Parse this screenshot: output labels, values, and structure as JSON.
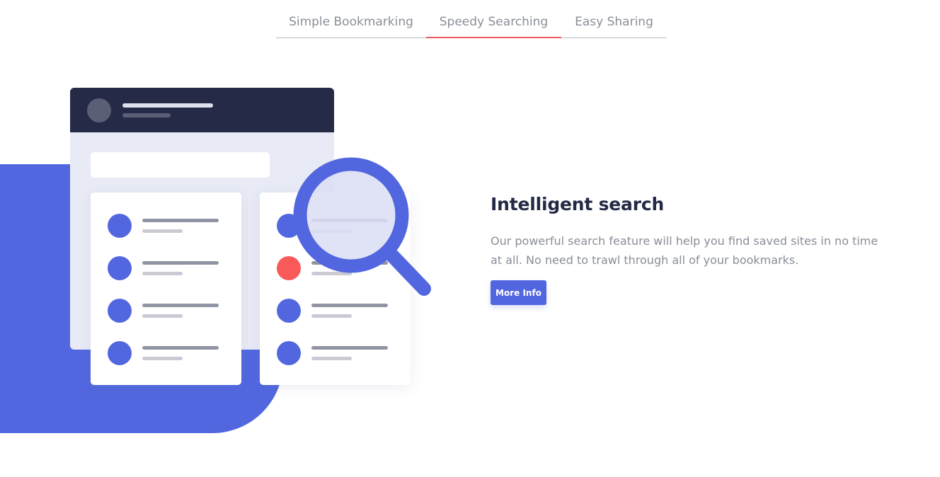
{
  "tabs": [
    {
      "label": "Simple Bookmarking",
      "active": false
    },
    {
      "label": "Speedy Searching",
      "active": true
    },
    {
      "label": "Easy Sharing",
      "active": false
    }
  ],
  "feature": {
    "title": "Intelligent search",
    "description": "Our powerful search feature will help you find saved sites in no time at all. No need to trawl through all of your bookmarks.",
    "button_label": "More Info"
  },
  "colors": {
    "brand_blue": "#5267df",
    "accent_red": "#fa5959",
    "dark_navy": "#242a45",
    "gray_text": "#9194a2"
  },
  "illustration": {
    "icon": "magnifying-glass-icon"
  }
}
